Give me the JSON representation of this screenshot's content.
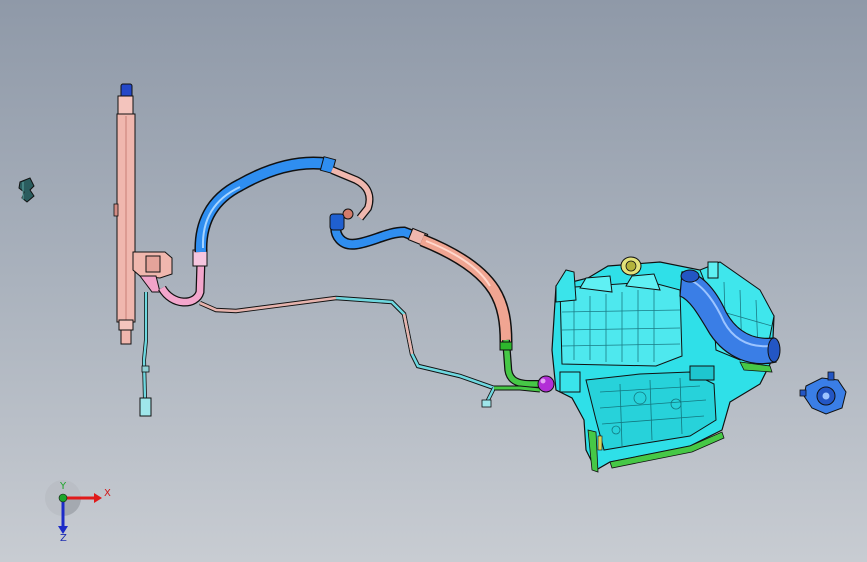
{
  "triad": {
    "x_label": "X",
    "y_label": "Y",
    "z_label": "Z",
    "x_color": "#e01a1a",
    "y_color": "#1ea52a",
    "z_color": "#1c2bc8"
  },
  "colors": {
    "receiver_drier": "#f0b7ae",
    "pink_tube": "#f3a6cc",
    "blue_hose": "#2f8ef0",
    "salmon_hose": "#f0a592",
    "cyan_line": "#6fd8e0",
    "hvac_cyan": "#2fe0e8",
    "green_pipe": "#46c846",
    "magenta_valve": "#b22fd6",
    "yellow_collar": "#e2e27a",
    "outline": "#1a1a1a"
  }
}
